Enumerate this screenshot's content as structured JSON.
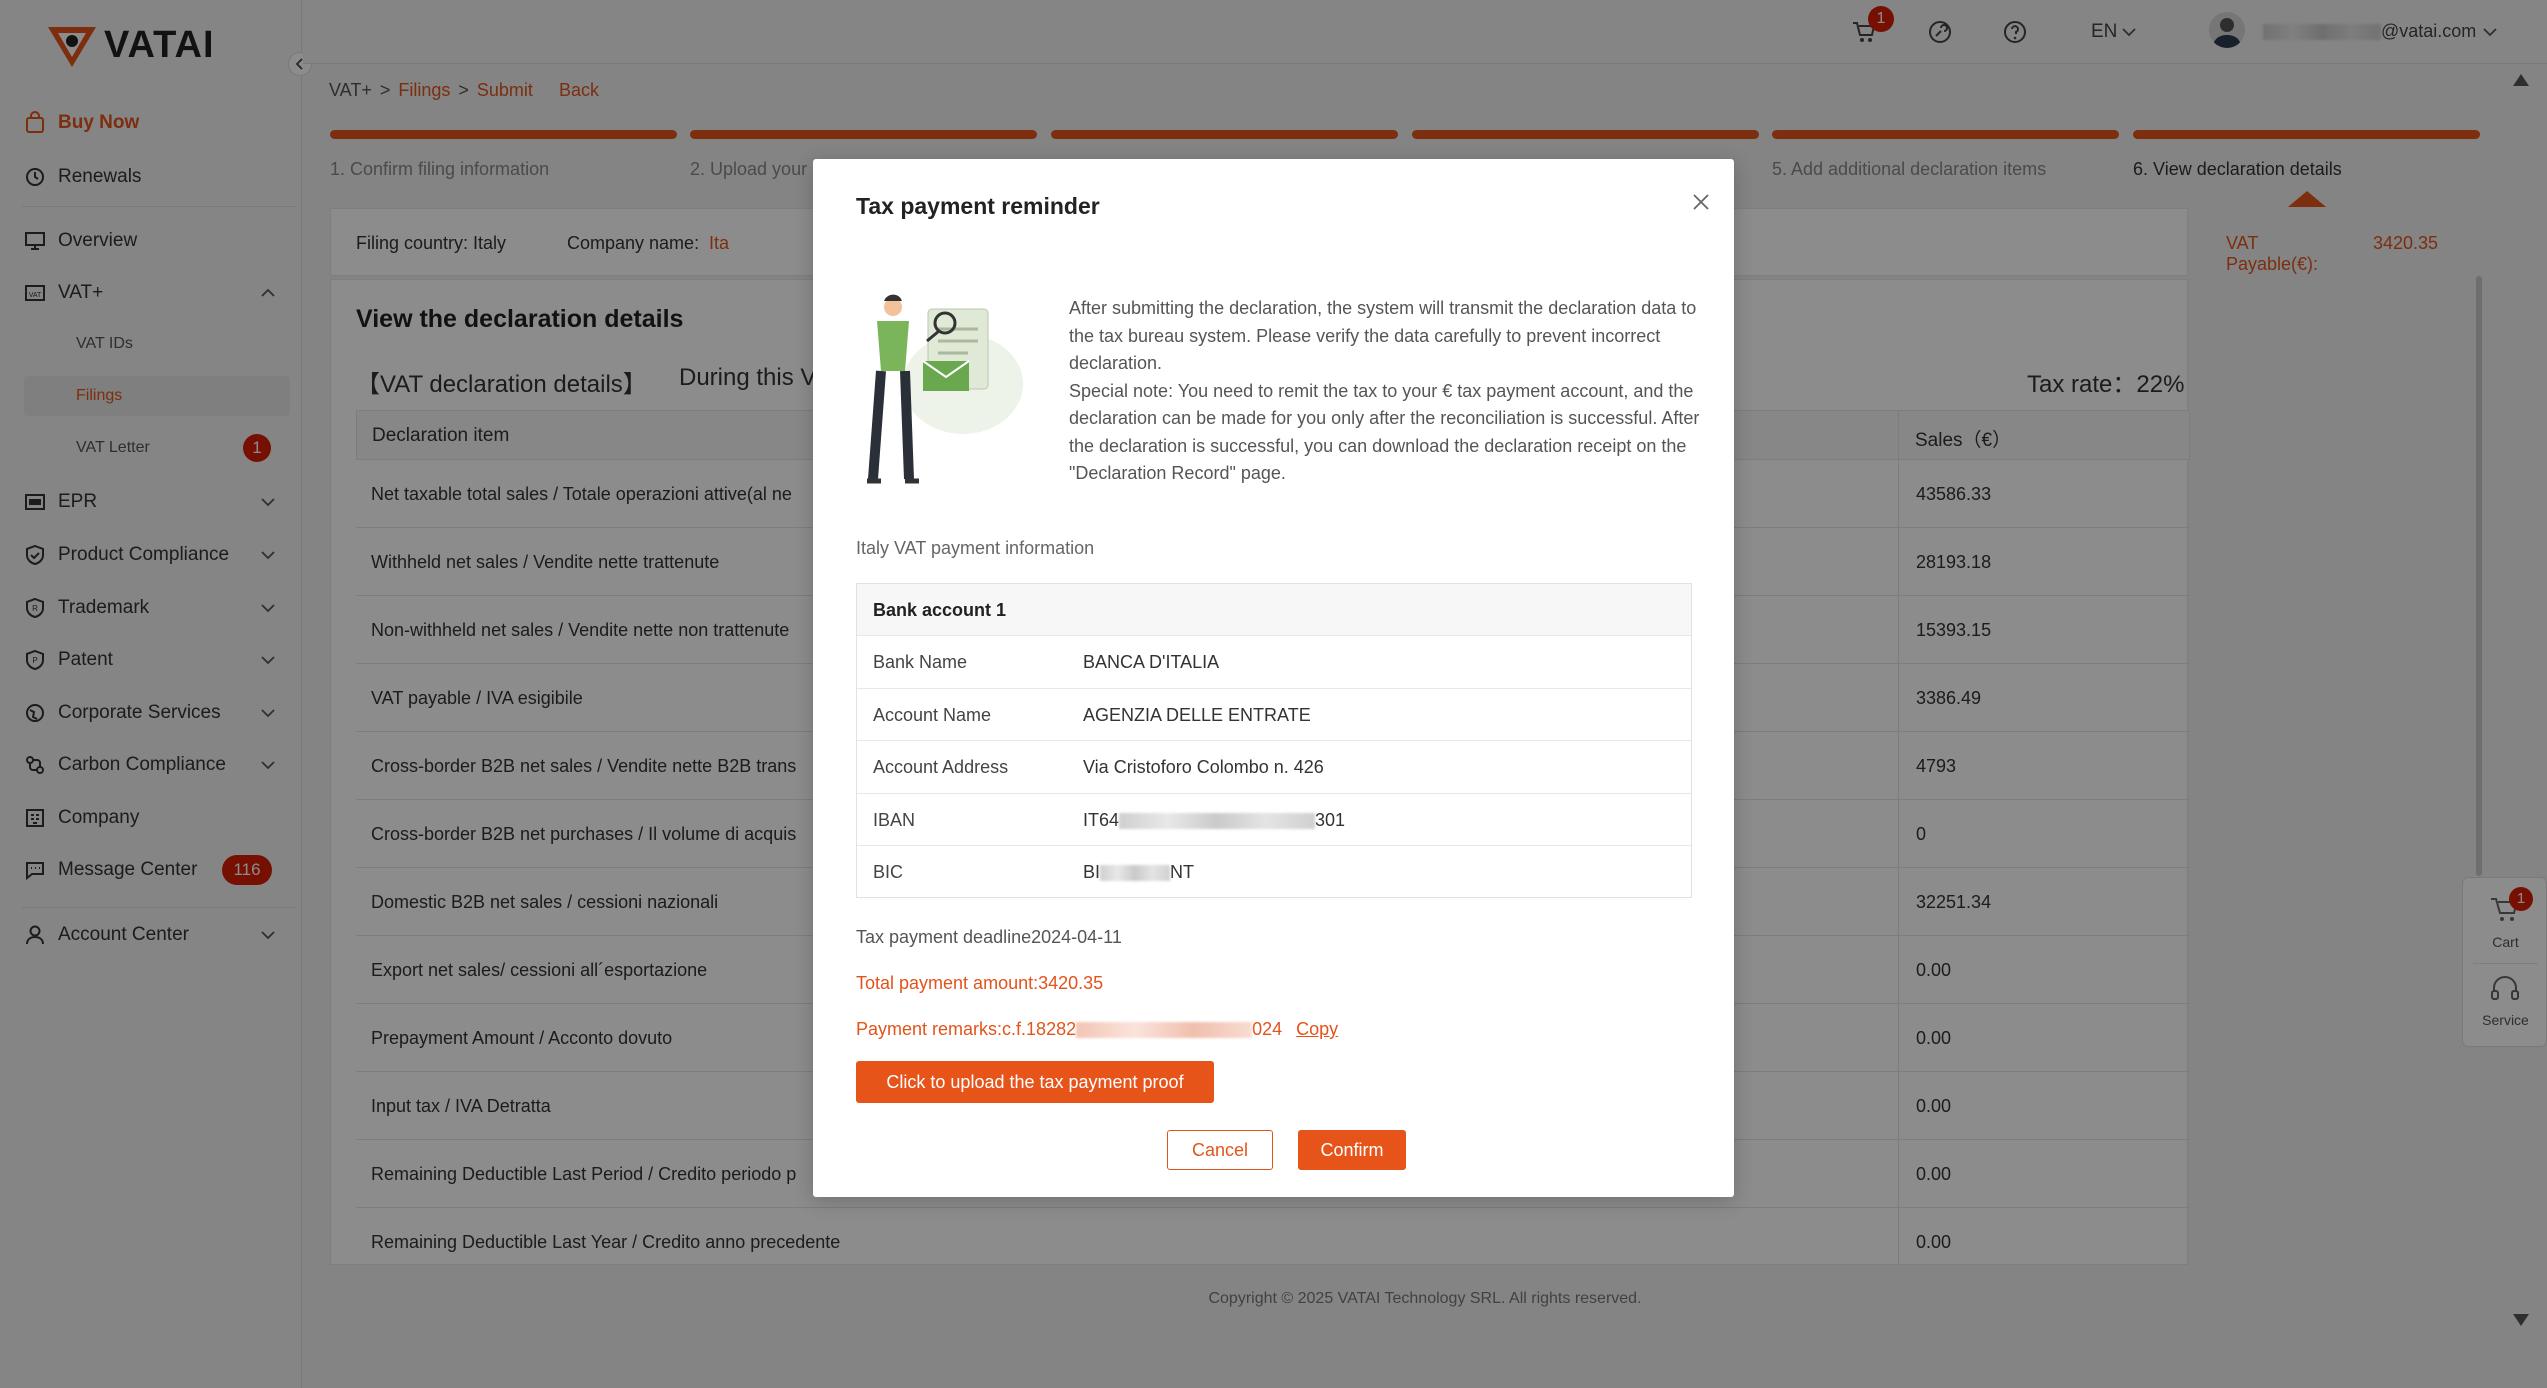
{
  "app": {
    "logo_text": "VATAI"
  },
  "sidebar": {
    "buy_now": "Buy Now",
    "renewals": "Renewals",
    "overview": "Overview",
    "vat_plus": "VAT+",
    "vat_ids": "VAT IDs",
    "filings": "Filings",
    "vat_letter": "VAT Letter",
    "vat_letter_badge": "1",
    "epr": "EPR",
    "product_compliance": "Product Compliance",
    "trademark": "Trademark",
    "patent": "Patent",
    "corporate_services": "Corporate Services",
    "carbon_compliance": "Carbon Compliance",
    "company": "Company",
    "message_center": "Message Center",
    "message_badge": "116",
    "account_center": "Account Center"
  },
  "topbar": {
    "cart_badge": "1",
    "language": "EN",
    "user_email": "@vatai.com"
  },
  "breadcrumb": {
    "root": "VAT+",
    "sep1": ">",
    "filings": "Filings",
    "sep2": ">",
    "submit": "Submit",
    "back": "Back"
  },
  "steps": [
    "1. Confirm filing information",
    "2. Upload your",
    "5. Add additional declaration items",
    "6. View declaration details"
  ],
  "info_bar": {
    "country": "Filing country: Italy",
    "company_label": "Company name:",
    "company_value": "Ita",
    "vat_payable_label": "VAT Payable(€):",
    "vat_payable_value": "3420.35"
  },
  "details": {
    "heading": "View the declaration details",
    "section_label": "【VAT declaration details】",
    "during": "During this V",
    "tax_rate": "Tax rate：22%",
    "col_item": "Declaration item",
    "col_sales": "Sales（€）",
    "rows": [
      {
        "item": "Net taxable total sales / Totale operazioni attive(al ne",
        "sales": "43586.33"
      },
      {
        "item": "Withheld net sales / Vendite nette trattenute",
        "sales": "28193.18"
      },
      {
        "item": "Non-withheld net sales / Vendite nette non trattenute",
        "sales": "15393.15"
      },
      {
        "item": "VAT payable / IVA esigibile",
        "sales": "3386.49"
      },
      {
        "item": "Cross-border B2B net sales / Vendite nette B2B trans",
        "sales": "4793"
      },
      {
        "item": "Cross-border B2B net purchases / Il volume di acquis",
        "sales": "0"
      },
      {
        "item": "Domestic B2B net sales / cessioni nazionali",
        "sales": "32251.34"
      },
      {
        "item": "Export net sales/ cessioni all´esportazione",
        "sales": "0.00"
      },
      {
        "item": "Prepayment Amount / Acconto dovuto",
        "sales": "0.00"
      },
      {
        "item": "Input tax / IVA Detratta",
        "sales": "0.00"
      },
      {
        "item": "Remaining Deductible Last Period / Credito periodo p",
        "sales": "0.00"
      },
      {
        "item": "Remaining Deductible Last Year / Credito anno precedente",
        "sales": "0.00"
      }
    ]
  },
  "footer": "Copyright © 2025 VATAI Technology SRL. All rights reserved.",
  "float_panel": {
    "cart": "Cart",
    "cart_badge": "1",
    "service": "Service"
  },
  "modal": {
    "title": "Tax payment reminder",
    "para1": "After submitting the declaration, the system will transmit the declaration data to the tax bureau system. Please verify the data carefully to prevent incorrect declaration.",
    "para2": "Special note: You need to remit the tax to your € tax payment account, and the declaration can be made for you only after the reconciliation is successful. After the declaration is successful, you can download the declaration receipt on the \"Declaration Record\" page.",
    "section": "Italy VAT payment information",
    "bank_title": "Bank account 1",
    "bank_rows": [
      {
        "key": "Bank Name",
        "value": "BANCA D'ITALIA"
      },
      {
        "key": "Account Name",
        "value": "AGENZIA DELLE ENTRATE"
      },
      {
        "key": "Account Address",
        "value": "Via Cristoforo Colombo n. 426"
      },
      {
        "key": "IBAN",
        "value_start": "IT64",
        "value_end": "301"
      },
      {
        "key": "BIC",
        "value_start": "BI",
        "value_end": "NT"
      }
    ],
    "deadline": "Tax payment deadline2024-04-11",
    "total": "Total payment amount:3420.35",
    "remarks_start": "Payment remarks:c.f.18282",
    "remarks_end": "024",
    "copy": "Copy",
    "upload_btn": "Click to upload the tax payment proof",
    "cancel": "Cancel",
    "confirm": "Confirm"
  }
}
